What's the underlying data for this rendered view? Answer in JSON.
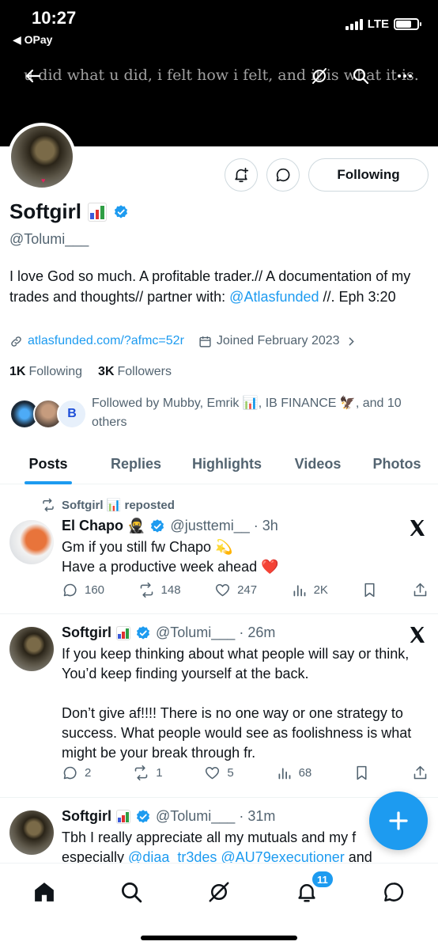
{
  "status_bar": {
    "time": "10:27",
    "back_app": "◀ OPay",
    "network": "LTE"
  },
  "banner": {
    "quote": "u did what u did, i felt how i felt, and it is what it is."
  },
  "profile": {
    "name": "Softgirl",
    "handle": "@Tolumi___",
    "follow_button": "Following",
    "bio_text": "I love God so much. A profitable trader.// A documentation of my trades and thoughts// partner with: ",
    "bio_link": "@Atlasfunded",
    "bio_tail": " //. Eph 3:20",
    "website": "atlasfunded.com/?afmc=52r",
    "joined": "Joined February 2023",
    "following_count": "1K",
    "following_label": "Following",
    "followers_count": "3K",
    "followers_label": "Followers",
    "followed_by": "Followed by Mubby, Emrik 📊, IB FINANCE 🦅, and 10 others"
  },
  "tabs": [
    "Posts",
    "Replies",
    "Highlights",
    "Videos",
    "Photos"
  ],
  "tweets": [
    {
      "repost_label": "Softgirl 📊 reposted",
      "name": "El Chapo 🥷",
      "meta": "@justtemi__ · 3h",
      "text1": "Gm if you still fw Chapo 💫",
      "text2": "Have a productive week ahead ❤️",
      "replies": "160",
      "reposts": "148",
      "likes": "247",
      "views": "2K"
    },
    {
      "name": "Softgirl",
      "meta": "@Tolumi___ · 26m",
      "text1": "If you keep thinking about what people will say or think, You’d keep finding yourself at the back.",
      "text2": "Don’t give af!!!! There is no one way or one strategy to success. What people would see as foolishness is what might be your break through fr.",
      "replies": "2",
      "reposts": "1",
      "likes": "5",
      "views": "68"
    },
    {
      "name": "Softgirl",
      "meta": "@Tolumi___ · 31m",
      "text1": "Tbh I really appreciate all my mutuals and my f",
      "text2_prefix": "especially ",
      "mention1": "@diaa_tr3des",
      "mention2": "@AU79executioner",
      "text2_suffix": " and"
    }
  ],
  "nav": {
    "notifications_badge": "11"
  },
  "colors": {
    "accent": "#1d9bf0",
    "text": "#0f1419",
    "muted": "#536471",
    "banner": "#000000"
  }
}
